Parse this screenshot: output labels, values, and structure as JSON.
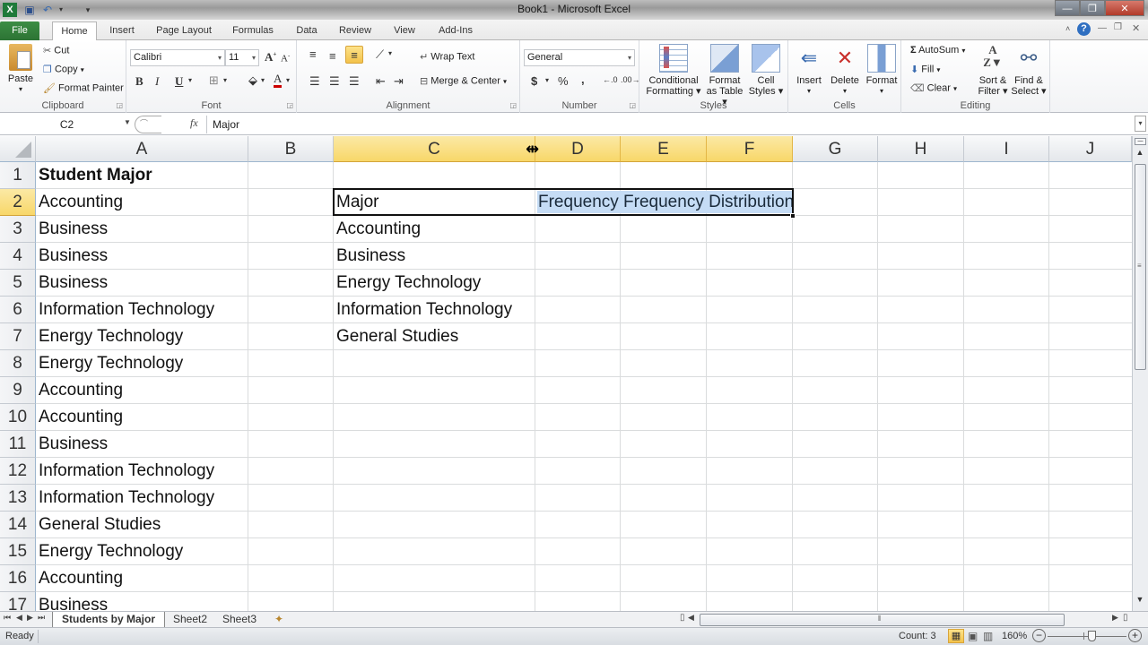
{
  "window": {
    "title": "Book1  -  Microsoft Excel",
    "quick_access": [
      "excel-logo",
      "save",
      "undo",
      "customize"
    ],
    "controls": {
      "minimize": "—",
      "restore": "❐",
      "close": "✕"
    }
  },
  "ribbon_tabs": [
    {
      "label": "File",
      "active": false
    },
    {
      "label": "Home",
      "active": true
    },
    {
      "label": "Insert",
      "active": false
    },
    {
      "label": "Page Layout",
      "active": false
    },
    {
      "label": "Formulas",
      "active": false
    },
    {
      "label": "Data",
      "active": false
    },
    {
      "label": "Review",
      "active": false
    },
    {
      "label": "View",
      "active": false
    },
    {
      "label": "Add-Ins",
      "active": false
    }
  ],
  "ribbon": {
    "clipboard": {
      "label": "Clipboard",
      "paste": "Paste",
      "cut": "Cut",
      "copy": "Copy",
      "format_painter": "Format Painter"
    },
    "font": {
      "label": "Font",
      "font_name": "Calibri",
      "font_size": "11",
      "bold": "B",
      "italic": "I",
      "underline": "U",
      "font_color": "#cc0000",
      "fill_color": "#ffff00"
    },
    "alignment": {
      "label": "Alignment",
      "wrap_text": "Wrap Text",
      "merge_center": "Merge & Center"
    },
    "number": {
      "label": "Number",
      "format": "General",
      "currency": "$",
      "percent": "%",
      "comma": ","
    },
    "styles": {
      "label": "Styles",
      "conditional_formatting": [
        "Conditional",
        "Formatting ▾"
      ],
      "format_as_table": [
        "Format",
        "as Table ▾"
      ],
      "cell_styles": [
        "Cell",
        "Styles ▾"
      ]
    },
    "cells": {
      "label": "Cells",
      "insert": "Insert",
      "delete": "Delete",
      "format": "Format"
    },
    "editing": {
      "label": "Editing",
      "autosum": "AutoSum",
      "fill": "Fill",
      "clear": "Clear",
      "sort_filter": [
        "Sort &",
        "Filter ▾"
      ],
      "find_select": [
        "Find &",
        "Select ▾"
      ]
    }
  },
  "formula_bar": {
    "name_box": "C2",
    "fx": "fx",
    "content": "Major"
  },
  "grid": {
    "columns": [
      "A",
      "B",
      "C",
      "D",
      "E",
      "F",
      "G",
      "H",
      "I",
      "J"
    ],
    "selected_columns": [
      "C",
      "D",
      "E",
      "F"
    ],
    "rows": [
      "1",
      "2",
      "3",
      "4",
      "5",
      "6",
      "7",
      "8",
      "9",
      "10",
      "11",
      "12",
      "13",
      "14",
      "15",
      "16",
      "17"
    ],
    "selected_row": "2",
    "column_a": [
      "Student Major",
      "Accounting",
      "Business",
      "Business",
      "Business",
      "Information Technology",
      "Energy Technology",
      "Energy Technology",
      "Accounting",
      "Accounting",
      "Business",
      "Information Technology",
      "Information Technology",
      "General Studies",
      "Energy Technology",
      "Accounting",
      "Business"
    ],
    "column_c": [
      "",
      "Major",
      "Accounting",
      "Business",
      "Energy Technology",
      "Information Technology",
      "General Studies"
    ],
    "d2_editing": "Frequency Frequency Distribution",
    "selection_range": "C2:F2",
    "highlight_color": "#c5dcf5",
    "header_selected_color": "#f8d769"
  },
  "sheet_tabs": [
    {
      "label": "Students by Major",
      "active": true
    },
    {
      "label": "Sheet2",
      "active": false
    },
    {
      "label": "Sheet3",
      "active": false
    }
  ],
  "status_bar": {
    "mode": "Ready",
    "count": "Count: 3",
    "zoom": "160%"
  }
}
